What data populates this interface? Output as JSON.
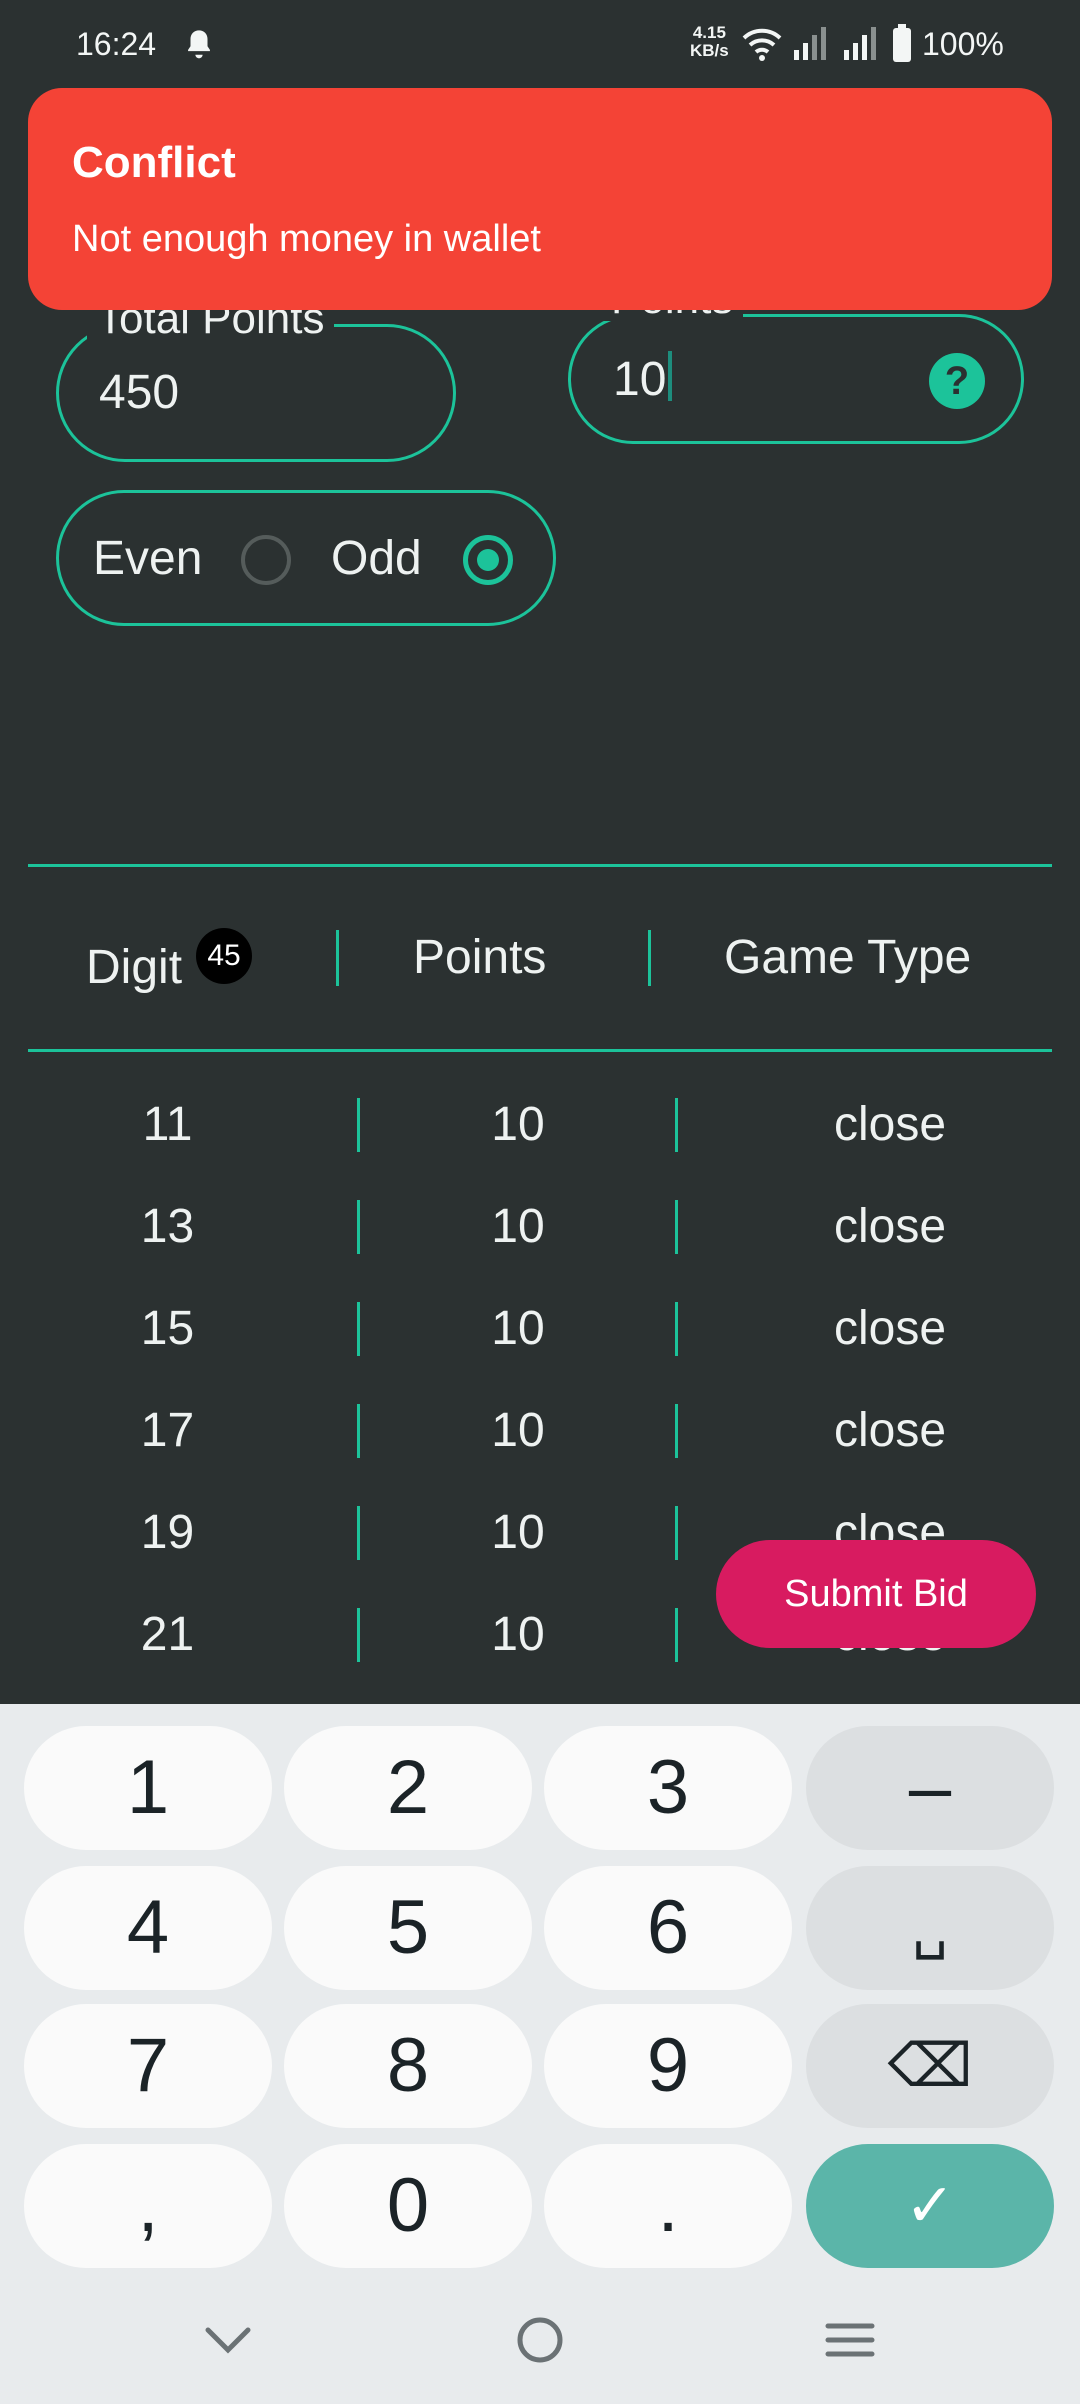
{
  "status_bar": {
    "time": "16:24",
    "net_speed_value": "4.15",
    "net_speed_unit": "KB/s",
    "battery": "100%",
    "icons": [
      "bell-icon",
      "wifi-icon",
      "signal-icon",
      "signal-icon",
      "battery-icon"
    ]
  },
  "snackbar": {
    "title": "Conflict",
    "message": "Not enough money in wallet",
    "color": "#f44336"
  },
  "form": {
    "total_points_label": "Total Points",
    "total_points_value": "450",
    "points_label": "Points",
    "points_value": "10",
    "help_icon": "?",
    "even_label": "Even",
    "odd_label": "Odd",
    "selected": "Odd"
  },
  "table": {
    "headers": {
      "digit": "Digit",
      "points": "Points",
      "game_type": "Game Type"
    },
    "digit_count": "45",
    "rows": [
      {
        "digit": "11",
        "points": "10",
        "type": "close"
      },
      {
        "digit": "13",
        "points": "10",
        "type": "close"
      },
      {
        "digit": "15",
        "points": "10",
        "type": "close"
      },
      {
        "digit": "17",
        "points": "10",
        "type": "close"
      },
      {
        "digit": "19",
        "points": "10",
        "type": "close"
      },
      {
        "digit": "21",
        "points": "10",
        "type": "close"
      }
    ]
  },
  "submit_label": "Submit Bid",
  "keyboard": {
    "keys": [
      "1",
      "2",
      "3",
      "–",
      "4",
      "5",
      "6",
      "␣",
      "7",
      "8",
      "9",
      "⌫",
      ",",
      "0",
      ".",
      "✓"
    ]
  },
  "colors": {
    "background": "#2b3131",
    "accent": "#1cc39a",
    "submit": "#d81b60",
    "keyboard_done": "#5bb5a9"
  }
}
